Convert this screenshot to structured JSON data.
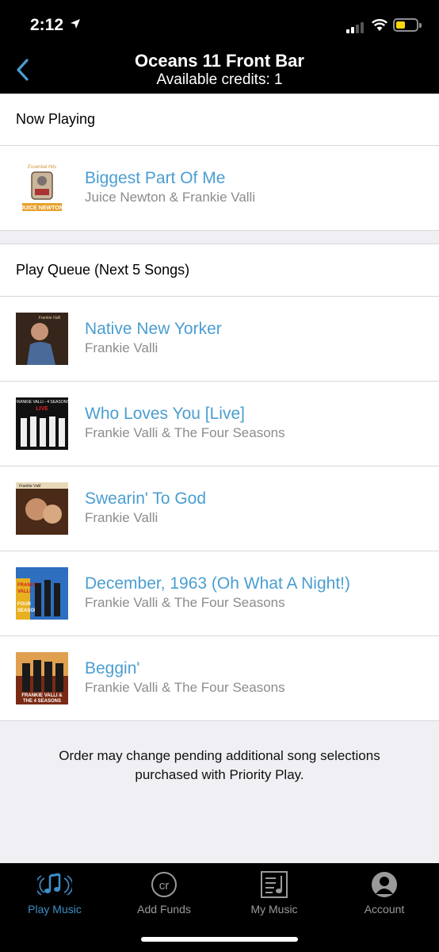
{
  "status_bar": {
    "time": "2:12"
  },
  "nav": {
    "title": "Oceans 11 Front Bar",
    "subtitle": "Available credits: 1"
  },
  "now_playing": {
    "header": "Now Playing",
    "track": {
      "title": "Biggest Part Of Me",
      "artist": "Juice Newton & Frankie Valli"
    }
  },
  "queue": {
    "header": "Play Queue (Next 5 Songs)",
    "items": [
      {
        "title": "Native New Yorker",
        "artist": "Frankie Valli"
      },
      {
        "title": "Who Loves You [Live]",
        "artist": "Frankie Valli & The Four Seasons"
      },
      {
        "title": "Swearin' To God",
        "artist": "Frankie Valli"
      },
      {
        "title": "December, 1963 (Oh What A Night!)",
        "artist": "Frankie Valli & The Four Seasons"
      },
      {
        "title": "Beggin'",
        "artist": "Frankie Valli & The Four Seasons"
      }
    ]
  },
  "notice": {
    "line1": "Order may change pending additional song selections",
    "line2": "purchased with Priority Play."
  },
  "tabs": [
    {
      "label": "Play Music",
      "icon": "music-notes-icon",
      "active": true
    },
    {
      "label": "Add Funds",
      "icon": "credits-icon"
    },
    {
      "label": "My Music",
      "icon": "playlist-icon"
    },
    {
      "label": "Account",
      "icon": "account-icon"
    }
  ],
  "colors": {
    "accent": "#4a9ed1",
    "tab_active": "#3d8fc8",
    "background": "#efeff4"
  }
}
